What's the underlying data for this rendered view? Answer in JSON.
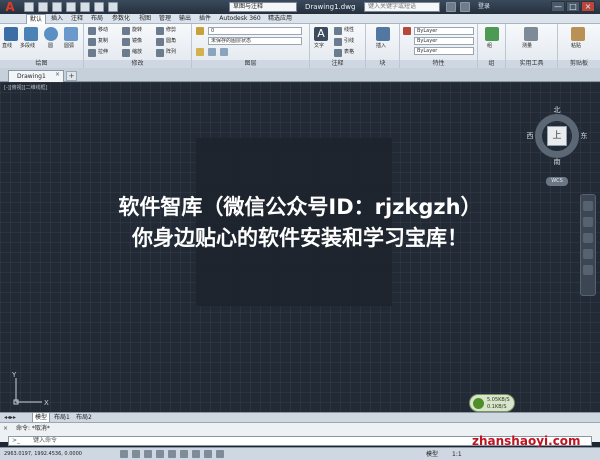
{
  "window": {
    "workspace": "草图与注释",
    "title": "Drawing1.dwg",
    "search_placeholder": "键入关键字或短语",
    "login": "登录",
    "controls": [
      "—",
      "□",
      "×"
    ]
  },
  "ribbon": {
    "tabs": [
      "默认",
      "插入",
      "注释",
      "布局",
      "参数化",
      "视图",
      "管理",
      "输出",
      "插件",
      "Autodesk 360",
      "精选应用"
    ],
    "groups": {
      "draw": {
        "title": "绘图",
        "tools": [
          "直线",
          "多段线",
          "圆",
          "圆弧"
        ]
      },
      "modify": {
        "title": "修改",
        "tools": [
          "移动",
          "旋转",
          "修剪",
          "复制",
          "镜像",
          "圆角",
          "拉伸",
          "缩放",
          "阵列"
        ]
      },
      "layers": {
        "title": "图层",
        "state": "未保存的图层状态",
        "current": "0"
      },
      "annotation": {
        "title": "注释",
        "tools": [
          "文字",
          "线性",
          "引线",
          "表格"
        ]
      },
      "block": {
        "title": "块",
        "tools": [
          "插入"
        ]
      },
      "properties": {
        "title": "特性",
        "values": [
          "ByLayer",
          "ByLayer",
          "ByLayer"
        ]
      },
      "groups": {
        "title": "组",
        "tools": [
          "组"
        ]
      },
      "utilities": {
        "title": "实用工具",
        "tools": [
          "测量"
        ]
      },
      "clipboard": {
        "title": "剪贴板",
        "tools": [
          "粘贴"
        ]
      }
    }
  },
  "file_tabs": {
    "active": "Drawing1",
    "new": "+"
  },
  "drawing": {
    "view_controls": "[-][俯视][二维线框]",
    "watermark_line1": "软件智库（微信公众号ID：rjzkgzh）",
    "watermark_line2": "你身边贴心的软件安装和学习宝库！",
    "viewcube": {
      "north": "北",
      "south": "南",
      "east": "东",
      "west": "西",
      "face": "上"
    },
    "wcs": "WCS",
    "ucs_x": "X",
    "ucs_y": "Y",
    "notification": [
      "5.05KB/S",
      "0.1KB/S"
    ]
  },
  "layout_tabs": [
    "模型",
    "布局1",
    "布局2"
  ],
  "command": {
    "history": "命令: *取消*",
    "prompt": "键入命令"
  },
  "status": {
    "coords": "2963.0197, 1992.4536, 0.0000",
    "model": "模型",
    "scale": "1:1"
  },
  "site_watermark": "zhanshaoyi.com"
}
